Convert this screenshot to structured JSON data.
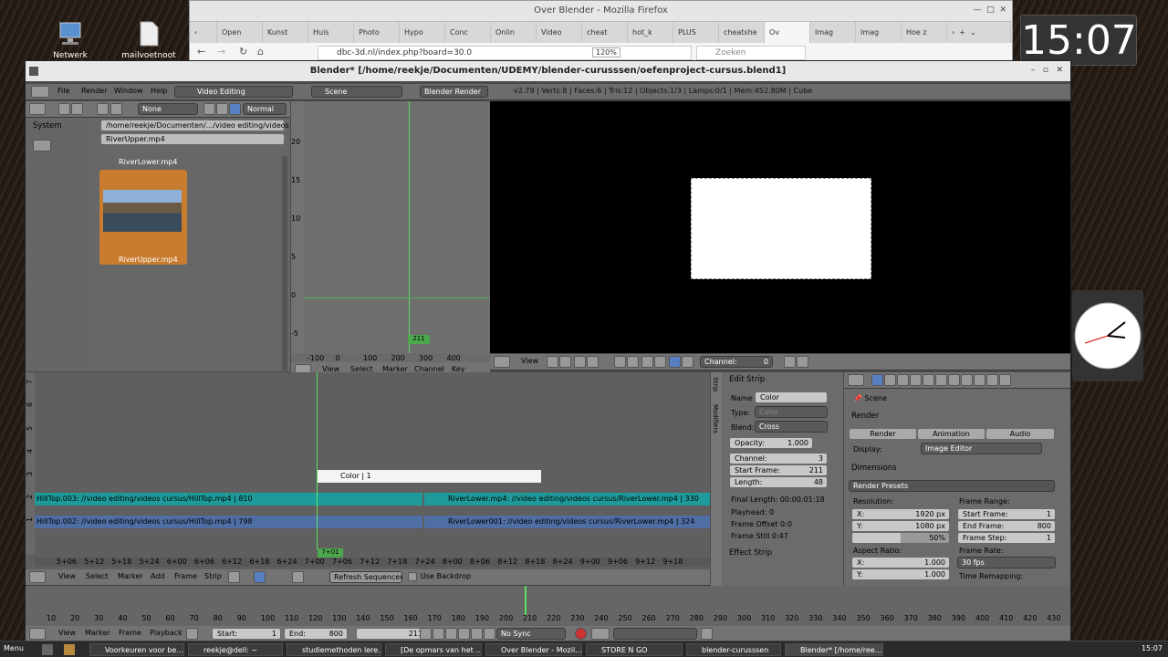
{
  "desktop": {
    "icons": [
      "Netwerk",
      "mailvoetnoot"
    ],
    "clock": "15:07"
  },
  "firefox": {
    "title": "Over Blender - Mozilla Firefox",
    "tabs": [
      "Open",
      "Kunst",
      "Huis",
      "Photo",
      "Hypo",
      "Conc",
      "Onlin",
      "Video",
      "cheat",
      "hot_k",
      "PLUS",
      "cheatshe",
      "Ov",
      "Imag",
      "Imag",
      "Hoe z"
    ],
    "url": "dbc-3d.nl/index.php?board=30.0",
    "zoom": "120%",
    "search_placeholder": "Zoeken"
  },
  "blender": {
    "title": "Blender* [/home/reekje/Documenten/UDEMY/blender-curusssen/oefenproject-cursus.blend1]",
    "menu": [
      "File",
      "Render",
      "Window",
      "Help"
    ],
    "layout": "Video Editing",
    "scene": "Scene",
    "engine": "Blender Render",
    "stats": "v2.79 | Verts:8 | Faces:6 | Tris:12 | Objects:1/3 | Lamps:0/1 | Mem:452.80M | Cube",
    "filebrowser": {
      "system": "System",
      "path": "/home/reekje/Documenten/.../video editing/videos cursus/",
      "file": "RiverUpper.mp4",
      "none": "None",
      "normal": "Normal",
      "thumb1": "RiverLower.mp4",
      "thumb2": "RiverUpper.mp4"
    },
    "graph": {
      "yticks": [
        "20",
        "15",
        "10",
        "5",
        "0",
        "-5"
      ],
      "xticks": [
        "-100",
        "0",
        "100",
        "200",
        "300",
        "400"
      ],
      "frame": "211",
      "menu": [
        "View",
        "Select",
        "Marker",
        "Channel",
        "Key"
      ]
    },
    "preview": {
      "menu": [
        "View"
      ],
      "channel": "Channel:",
      "channel_val": "0"
    },
    "sequencer": {
      "strips": [
        {
          "label": "Color | 1",
          "kind": "color"
        },
        {
          "label": "HillTop.003: //video editing/videos cursus/HillTop.mp4 | 810",
          "kind": "teal"
        },
        {
          "label": "RiverLower.mp4: //video editing/videos cursus/RiverLower.mp4 | 330",
          "kind": "teal"
        },
        {
          "label": "HillTop.002: //video editing/videos cursus/HillTop.mp4 | 798",
          "kind": "blue"
        },
        {
          "label": "RiverLower001: //video editing/videos cursus/RiverLower.mp4 | 324",
          "kind": "blue"
        }
      ],
      "channels": [
        "7",
        "6",
        "5",
        "4",
        "3",
        "2",
        "1"
      ],
      "ticks": [
        "5+06",
        "5+12",
        "5+18",
        "5+24",
        "6+00",
        "6+06",
        "6+12",
        "6+18",
        "6+24",
        "7+00",
        "7+06",
        "7+12",
        "7+18",
        "7+24",
        "8+00",
        "8+06",
        "8+12",
        "8+18",
        "8+24",
        "9+00",
        "9+06",
        "9+12",
        "9+18"
      ],
      "current": "7+01",
      "menu": [
        "View",
        "Select",
        "Marker",
        "Add",
        "Frame",
        "Strip"
      ],
      "refresh": "Refresh Sequencer",
      "backdrop": "Use Backdrop"
    },
    "strip_panel": {
      "tabs": [
        "Strip",
        "Modifiers"
      ],
      "edit_strip": "Edit Strip",
      "name_lbl": "Name",
      "name": "Color",
      "type_lbl": "Type:",
      "type": "Color",
      "blend_lbl": "Blend:",
      "blend": "Cross",
      "opacity": "Opacity:",
      "opacity_val": "1.000",
      "channel": "Channel:",
      "channel_val": "3",
      "start": "Start Frame:",
      "start_val": "211",
      "length": "Length:",
      "length_val": "48",
      "final": "Final Length: 00:00:01:18",
      "playhead": "Playhead: 0",
      "offset": "Frame Offset 0:0",
      "still": "Frame Still 0:47",
      "effect": "Effect Strip"
    },
    "properties": {
      "scene": "Scene",
      "render": "Render",
      "btn_render": "Render",
      "btn_anim": "Animation",
      "btn_audio": "Audio",
      "display_lbl": "Display:",
      "display": "Image Editor",
      "dimensions": "Dimensions",
      "presets": "Render Presets",
      "resolution": "Resolution:",
      "res_x": "1920 px",
      "res_y": "1080 px",
      "res_pct": "50%",
      "frame_range": "Frame Range:",
      "start": "1",
      "end": "800",
      "step": "1",
      "aspect": "Aspect Ratio:",
      "asp_x": "1.000",
      "asp_y": "1.000",
      "framerate_lbl": "Frame Rate:",
      "framerate": "30 fps",
      "remap": "Time Remapping:"
    },
    "timeline": {
      "ticks": [
        "10",
        "20",
        "30",
        "40",
        "50",
        "60",
        "70",
        "80",
        "90",
        "100",
        "110",
        "120",
        "130",
        "140",
        "150",
        "160",
        "170",
        "180",
        "190",
        "200",
        "210",
        "220",
        "230",
        "240",
        "250",
        "260",
        "270",
        "280",
        "290",
        "300",
        "310",
        "320",
        "330",
        "340",
        "350",
        "360",
        "370",
        "380",
        "390",
        "400",
        "410",
        "420",
        "430"
      ],
      "menu": [
        "View",
        "Marker",
        "Frame",
        "Playback"
      ],
      "start": "Start:",
      "start_val": "1",
      "end": "End:",
      "end_val": "800",
      "frame": "211",
      "sync": "No Sync"
    }
  },
  "taskbar": {
    "menu": "Menu",
    "tasks": [
      "Voorkeuren voor be...",
      "reekje@dell: ~",
      "studiemethoden lere...",
      "[De opmars van het ...",
      "Over Blender - Mozil...",
      "STORE N GO",
      "blender-curusssen",
      "Blender* [/home/ree..."
    ],
    "time": "15:07"
  }
}
